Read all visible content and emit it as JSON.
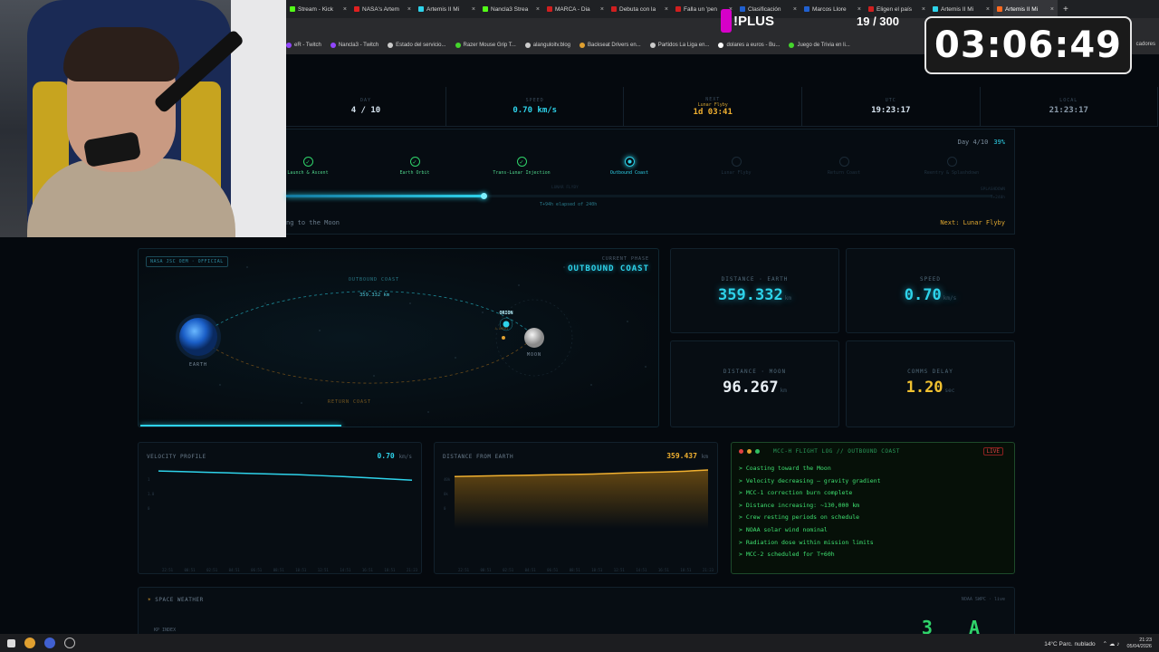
{
  "browser": {
    "tabs": [
      {
        "label": "Stream - Kick",
        "color": "#53fc18"
      },
      {
        "label": "NASA's Artem",
        "color": "#e02020"
      },
      {
        "label": "Artemis II Mi",
        "color": "#2ed3ea"
      },
      {
        "label": "Nancla3 Strea",
        "color": "#53fc18"
      },
      {
        "label": "MARCA - Dia",
        "color": "#d01f1f"
      },
      {
        "label": "Debuta con la",
        "color": "#d01f1f"
      },
      {
        "label": "Falla un 'pen",
        "color": "#d01f1f"
      },
      {
        "label": "Clasificación",
        "color": "#2060d0"
      },
      {
        "label": "Marcos Llore",
        "color": "#2060d0"
      },
      {
        "label": "Eligen el país",
        "color": "#d01f1f"
      },
      {
        "label": "Artemis II Mi",
        "color": "#2ed3ea"
      },
      {
        "label": "Artemis II Mi",
        "color": "#ff6a20"
      }
    ],
    "active_tab_index": 11,
    "new_tab": "+",
    "bookmarks": [
      {
        "label": "eR - Twitch",
        "color": "#9146ff"
      },
      {
        "label": "Nancla3 - Twitch",
        "color": "#9146ff"
      },
      {
        "label": "Estado del servicio...",
        "color": "#cccccc"
      },
      {
        "label": "Razer Mouse Grip T...",
        "color": "#44d62c"
      },
      {
        "label": "alanguloitv.blog",
        "color": "#cccccc"
      },
      {
        "label": "Backseat Drivers en...",
        "color": "#e0a030"
      },
      {
        "label": "Partidos La Liga en...",
        "color": "#cccccc"
      },
      {
        "label": "dolares a euros - Bu...",
        "color": "#ffffff"
      },
      {
        "label": "Juego de Trivia en li...",
        "color": "#44d62c"
      }
    ],
    "bookmarks_right": "cadores"
  },
  "overlay": {
    "plus_text": "!PLUS",
    "counter": "19 / 300",
    "timer": "03:06:49"
  },
  "status": [
    {
      "label": "DAY",
      "value": "4 / 10",
      "style": "white"
    },
    {
      "label": "SPEED",
      "value": "0.70 km/s",
      "style": "cyan"
    },
    {
      "label": "NEXT",
      "sub": "Lunar Flyby",
      "value": "1d 03:41",
      "style": "amber"
    },
    {
      "label": "UTC",
      "value": "19:23:17",
      "style": "white"
    },
    {
      "label": "LOCAL",
      "value": "21:23:17",
      "style": "dim"
    }
  ],
  "progress": {
    "day_text": "Day 4/10",
    "percent": "39%",
    "fraction": 0.39,
    "phases": [
      {
        "label": "Launch & Ascent",
        "state": "done"
      },
      {
        "label": "Earth Orbit",
        "state": "done"
      },
      {
        "label": "Trans-Lunar Injection",
        "state": "done"
      },
      {
        "label": "Outbound Coast",
        "state": "current"
      },
      {
        "label": "Lunar Flyby",
        "state": "future"
      },
      {
        "label": "Return Coast",
        "state": "future"
      },
      {
        "label": "Reentry & Splashdown",
        "state": "future"
      }
    ],
    "flyby_label": "LUNAR FLYBY",
    "elapsed": "T+94h elapsed of 240h",
    "splashdown": "SPLASHDOWN",
    "splash_time": "T+240h",
    "coasting_text": "ng to the Moon",
    "next_text": "Next: Lunar Flyby"
  },
  "orbit": {
    "source_badge": "NASA JSC OEM · OFFICIAL",
    "current_phase_label": "CURRENT PHASE",
    "current_phase_value": "OUTBOUND COAST",
    "outbound_label": "OUTBOUND COAST",
    "return_label": "RETURN COAST",
    "distance_label": "359.332 km",
    "earth_label": "EARTH",
    "moon_label": "MOON",
    "orion_label": "ORION",
    "orion_sub": "A.AMERI"
  },
  "metrics": [
    {
      "label": "DISTANCE · EARTH",
      "value": "359.332",
      "unit": "km",
      "color": "#2ed3ea"
    },
    {
      "label": "SPEED",
      "value": "0.70",
      "unit": "km/s",
      "color": "#2ed3ea"
    },
    {
      "label": "DISTANCE · MOON",
      "value": "96.267",
      "unit": "km",
      "color": "#e8eef4"
    },
    {
      "label": "COMMS DELAY",
      "value": "1.20",
      "unit": "sec",
      "color": "#f0c030"
    }
  ],
  "velocity_chart": {
    "title": "VELOCITY PROFILE",
    "value": "0.70",
    "unit": "km/s",
    "y_ticks": [
      "1",
      "1.0",
      "0"
    ],
    "x_ticks": [
      "22:51",
      "00:51",
      "02:51",
      "04:51",
      "06:51",
      "08:51",
      "10:51",
      "12:51",
      "14:51",
      "16:51",
      "18:51",
      "21:23"
    ],
    "values": [
      1.0,
      0.98,
      0.96,
      0.94,
      0.92,
      0.9,
      0.88,
      0.85,
      0.82,
      0.78,
      0.74,
      0.7
    ]
  },
  "distance_chart": {
    "title": "DISTANCE FROM EARTH",
    "value": "359.437",
    "unit": "km",
    "y_ticks": [
      "40k",
      "0k",
      "0"
    ],
    "x_ticks": [
      "22:51",
      "00:51",
      "02:51",
      "04:51",
      "06:51",
      "08:51",
      "10:51",
      "12:51",
      "14:51",
      "16:51",
      "18:51",
      "21:23"
    ],
    "values": [
      0.84,
      0.85,
      0.86,
      0.87,
      0.88,
      0.89,
      0.9,
      0.92,
      0.94,
      0.95,
      0.97,
      1.0
    ]
  },
  "flight_log": {
    "title": "MCC-H FLIGHT LOG // OUTBOUND COAST",
    "live": "LIVE",
    "lines": [
      "> Coasting toward the Moon",
      "> Velocity decreasing — gravity gradient",
      "> MCC-1 correction burn complete",
      "> Distance increasing: ~130,000 km",
      "> Crew resting periods on schedule",
      "> NOAA solar wind nominal",
      "> Radiation dose within mission limits",
      "> MCC-2 scheduled for T+60h"
    ]
  },
  "space_weather": {
    "title": "SPACE WEATHER",
    "source": "NOAA SWPC · live",
    "kp_label": "KP INDEX",
    "kp_value": "3 A"
  },
  "taskbar": {
    "weather": "14°C  Parc. nublado",
    "time": "21:23",
    "date": "05/04/2026"
  }
}
